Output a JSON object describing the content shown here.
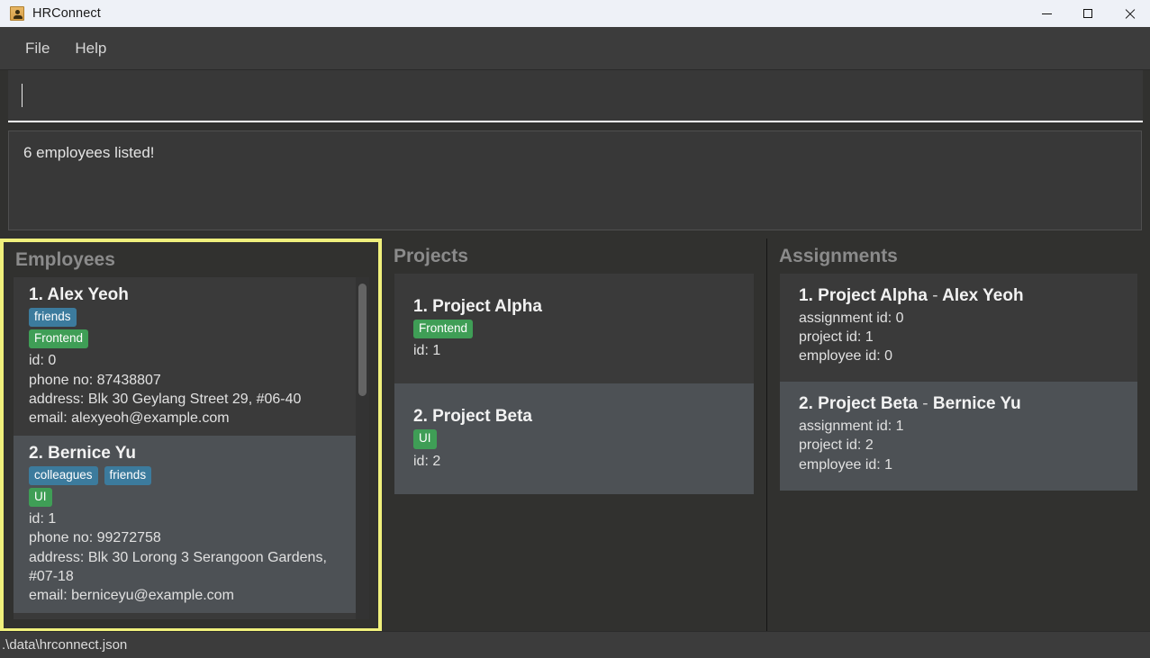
{
  "window": {
    "title": "HRConnect",
    "icon": "person-badge-icon",
    "controls": {
      "minimize": "minimize-icon",
      "maximize": "maximize-icon",
      "close": "close-icon"
    }
  },
  "menu": {
    "items": [
      {
        "label": "File"
      },
      {
        "label": "Help"
      }
    ]
  },
  "command": {
    "value": "",
    "placeholder": ""
  },
  "result": {
    "text": "6 employees listed!"
  },
  "colors": {
    "accent_yellow": "#f0f07c",
    "tag_blue": "#3c7b9d",
    "tag_green": "#3f9e56",
    "panel_bg": "#31312f",
    "card_bg": "#3a3a3a",
    "card_bg_alt": "#4d5155",
    "titlebar_bg": "#eef1f7",
    "menubar_bg": "#3c3c3c"
  },
  "panels": {
    "employees": {
      "header": "Employees",
      "selected": true,
      "scrollbar": {
        "visible": true
      },
      "cards": [
        {
          "title": "1. Alex Yeoh",
          "tags": [
            {
              "label": "friends",
              "color": "blue"
            },
            {
              "label": "Frontend",
              "color": "green"
            }
          ],
          "lines": [
            "id: 0",
            "phone no: 87438807",
            "address: Blk 30 Geylang Street 29, #06-40",
            "email: alexyeoh@example.com"
          ]
        },
        {
          "title": "2. Bernice Yu",
          "tags": [
            {
              "label": "colleagues",
              "color": "blue"
            },
            {
              "label": "friends",
              "color": "blue"
            },
            {
              "label": "UI",
              "color": "green"
            }
          ],
          "lines": [
            "id: 1",
            "phone no: 99272758",
            "address: Blk 30 Lorong 3 Serangoon Gardens, #07-18",
            "email: berniceyu@example.com"
          ]
        }
      ]
    },
    "projects": {
      "header": "Projects",
      "selected": false,
      "cards": [
        {
          "title": "1. Project Alpha",
          "tags": [
            {
              "label": "Frontend",
              "color": "green"
            }
          ],
          "lines": [
            "id: 1"
          ]
        },
        {
          "title": "2. Project Beta",
          "tags": [
            {
              "label": "UI",
              "color": "green"
            }
          ],
          "lines": [
            "id: 2"
          ]
        }
      ]
    },
    "assignments": {
      "header": "Assignments",
      "selected": false,
      "cards": [
        {
          "title": "1. Project Alpha - Alex Yeoh",
          "title_index": "1.",
          "title_project": "Project Alpha",
          "title_sep": "-",
          "title_person": "Alex Yeoh",
          "tags": [],
          "lines": [
            "assignment id: 0",
            "project id: 1",
            "employee id: 0"
          ]
        },
        {
          "title": "2. Project Beta - Bernice Yu",
          "title_index": "2.",
          "title_project": "Project Beta",
          "title_sep": "-",
          "title_person": "Bernice Yu",
          "tags": [],
          "lines": [
            "assignment id: 1",
            "project id: 2",
            "employee id: 1"
          ]
        }
      ]
    }
  },
  "statusbar": {
    "path": ".\\data\\hrconnect.json"
  }
}
